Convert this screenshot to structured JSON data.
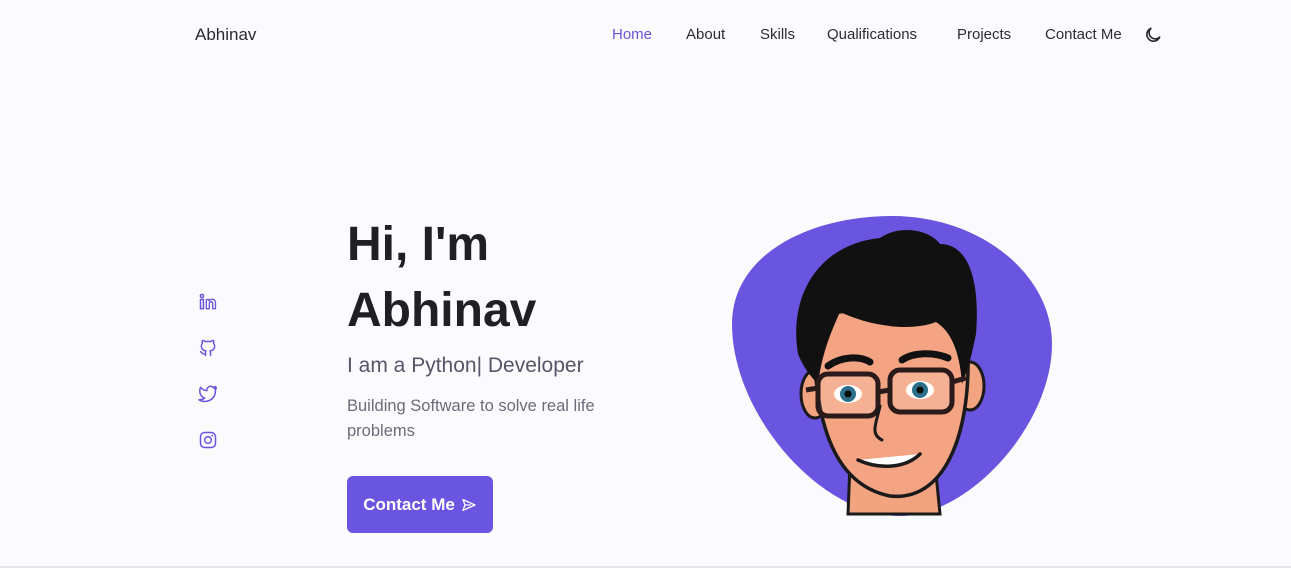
{
  "header": {
    "brand": "Abhinav",
    "nav": [
      "Home",
      "About",
      "Skills",
      "Qualifications",
      "Projects",
      "Contact Me"
    ],
    "active": "Home",
    "theme_icon": "moon-icon"
  },
  "socials": {
    "items": [
      "linkedin-icon",
      "github-icon",
      "twitter-icon",
      "instagram-icon"
    ]
  },
  "hero": {
    "greeting": "Hi, I'm",
    "name": "Abhinav",
    "subtitle": "I am a Python| Developer",
    "description": "Building Software to solve real life problems",
    "cta_label": "Contact Me",
    "cta_icon": "send-icon",
    "avatar": "avatar-illustration"
  },
  "colors": {
    "accent": "#6a55e0",
    "background": "#fbfbfd"
  }
}
